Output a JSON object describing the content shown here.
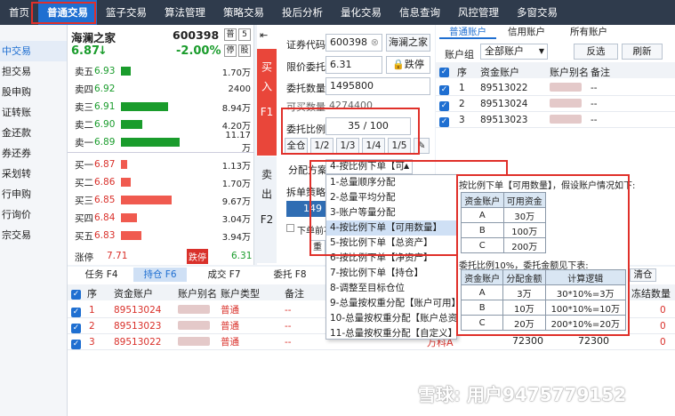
{
  "menu": [
    "首页",
    "普通交易",
    "篮子交易",
    "算法管理",
    "策略交易",
    "投后分析",
    "量化交易",
    "信息查询",
    "风控管理",
    "多窗交易"
  ],
  "leftnav": [
    "中交易",
    "担交易",
    "股申购",
    "证转账",
    "金还款",
    "券还券",
    "采划转",
    "行申购",
    "行询价",
    "宗交易"
  ],
  "stock": {
    "name": "海澜之家",
    "code": "600398",
    "price": "6.87",
    "change": "-2.00%",
    "arrow": "↓",
    "tag1": "普",
    "tag2": "5",
    "tag3": "停",
    "tag4": "股"
  },
  "asks": [
    {
      "label": "卖五",
      "price": "6.93",
      "bar": 0.1,
      "vol": "1.70万"
    },
    {
      "label": "卖四",
      "price": "6.92",
      "bar": 0,
      "vol": "2400"
    },
    {
      "label": "卖三",
      "price": "6.91",
      "bar": 0.48,
      "vol": "8.94万"
    },
    {
      "label": "卖二",
      "price": "6.90",
      "bar": 0.22,
      "vol": "4.20万"
    },
    {
      "label": "卖一",
      "price": "6.89",
      "bar": 0.6,
      "vol": "11.17万"
    }
  ],
  "bids": [
    {
      "label": "买一",
      "price": "6.87",
      "bar": 0.06,
      "vol": "1.13万"
    },
    {
      "label": "买二",
      "price": "6.86",
      "bar": 0.1,
      "vol": "1.70万"
    },
    {
      "label": "买三",
      "price": "6.85",
      "bar": 0.52,
      "vol": "9.67万"
    },
    {
      "label": "买四",
      "price": "6.84",
      "bar": 0.16,
      "vol": "3.04万"
    },
    {
      "label": "买五",
      "price": "6.83",
      "bar": 0.21,
      "vol": "3.94万"
    }
  ],
  "limits": {
    "up_label": "涨停",
    "up": "7.71",
    "down_label": "跌停",
    "down": "6.31"
  },
  "order": {
    "buy_side": "买入",
    "buy_key": "F1",
    "sell_side": "卖出",
    "sell_key": "F2",
    "code_label": "证券代码",
    "code": "600398",
    "code_name": "海澜之家",
    "price_label": "限价委托",
    "price": "6.31",
    "stop_label": "跌停",
    "qty_label": "委托数量",
    "qty": "1495800",
    "avail_label": "可买数量",
    "avail": "4274400",
    "ratio_label": "委托比例",
    "ratio_num": "35",
    "ratio_den": "100",
    "ratios": [
      "全仓",
      "1/2",
      "1/3",
      "1/4",
      "1/5"
    ],
    "alloc_label": "分配方案",
    "alloc_value": "4-按比例下单【可",
    "split_label": "拆单策略",
    "split_value": "149",
    "prev_label": "下单前不",
    "btn2": "重"
  },
  "dropdown": [
    "1-总量顺序分配",
    "2-总量平均分配",
    "3-账户等量分配",
    "4-按比例下单【可用数量】",
    "5-按比例下单【总资产】",
    "6-按比例下单【净资产】",
    "7-按比例下单【持仓】",
    "8-调整至目标仓位",
    "9-总量按权重分配【账户可用】",
    "10-总量按权重分配【账户总资产】",
    "11-总量按权重分配【自定义】"
  ],
  "right": {
    "tabs": [
      "普通账户",
      "信用账户",
      "所有账户"
    ],
    "group_label": "账户组",
    "group_value": "全部账户",
    "btns": [
      "反选",
      "刷新"
    ],
    "headers": [
      "序",
      "资金账户",
      "账户别名",
      "备注"
    ],
    "rows": [
      {
        "n": "1",
        "acct": "89513022",
        "note": "--"
      },
      {
        "n": "2",
        "acct": "89513024",
        "note": "--"
      },
      {
        "n": "3",
        "acct": "89513023",
        "note": "--"
      }
    ]
  },
  "info": {
    "title": "按比例下单【可用数量】，假设账户情况如下:",
    "t1_head": [
      "资金账户",
      "可用资金"
    ],
    "t1": [
      [
        "A",
        "30万"
      ],
      [
        "B",
        "100万"
      ],
      [
        "C",
        "200万"
      ]
    ],
    "title2": "委托比例10%，委托金额见下表:",
    "t2_head": [
      "资金账户",
      "分配金额",
      "计算逻辑"
    ],
    "t2": [
      [
        "A",
        "3万",
        "30*10%=3万"
      ],
      [
        "B",
        "10万",
        "100*10%=10万"
      ],
      [
        "C",
        "20万",
        "200*10%=20万"
      ]
    ]
  },
  "bottom": {
    "tabs": [
      "任务 F4",
      "持仓 F6",
      "成交 F7",
      "委托 F8"
    ],
    "headers": [
      "序",
      "资金账户",
      "账户别名",
      "账户类型",
      "备注"
    ],
    "rows": [
      {
        "n": "1",
        "acct": "89513024",
        "type": "普通",
        "note": "--",
        "v1": "0"
      },
      {
        "n": "2",
        "acct": "89513023",
        "type": "普通",
        "note": "--",
        "v1": "0"
      },
      {
        "n": "3",
        "acct": "89513022",
        "type": "普通",
        "note": "--",
        "v1": "0"
      }
    ],
    "row3_extra": [
      "72300",
      "72300",
      "万科A"
    ],
    "clear_btn": "清仓",
    "frozen": "冻结数量"
  },
  "watermark": "雪球: 用户9475779152",
  "colors": {
    "up": "#d9302a",
    "down": "#1a9c2c",
    "accent": "#1f6fd1",
    "highlight": "#e0302a"
  }
}
